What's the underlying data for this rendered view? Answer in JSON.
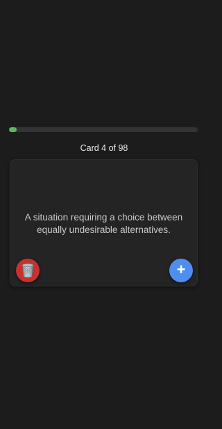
{
  "progress": {
    "current": 4,
    "total": 98,
    "fraction": 0.0408,
    "color": "#5cb85c"
  },
  "counter_text": "Card 4 of 98",
  "card": {
    "text": "A situation requiring a choice between equally undesirable alternatives."
  },
  "actions": {
    "delete_icon": "trash-can-icon",
    "delete_color": "#c7322e",
    "add_icon": "plus-icon",
    "add_symbol": "+",
    "add_color": "#4e8ef1"
  }
}
